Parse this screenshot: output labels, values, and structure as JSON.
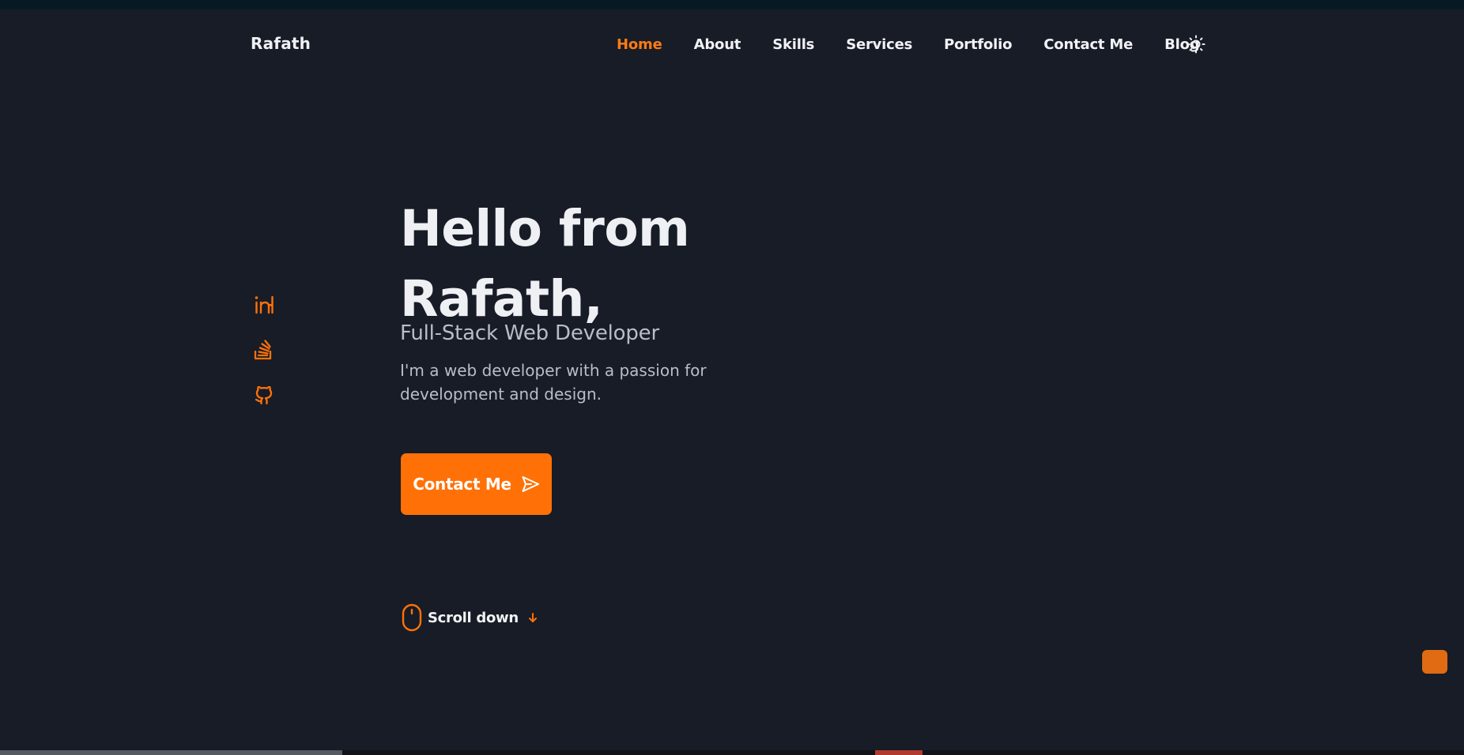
{
  "brand": {
    "name": "Rafath",
    "accent_color": "#ff7107"
  },
  "nav": {
    "items": [
      {
        "label": "Home",
        "active": true
      },
      {
        "label": "About"
      },
      {
        "label": "Skills"
      },
      {
        "label": "Services"
      },
      {
        "label": "Portfolio"
      },
      {
        "label": "Contact Me"
      },
      {
        "label": "Blog"
      }
    ],
    "theme_toggle_icon": "sun-icon"
  },
  "socials": [
    {
      "icon": "linkedin-icon"
    },
    {
      "icon": "stackoverflow-icon"
    },
    {
      "icon": "github-icon"
    }
  ],
  "hero": {
    "title_line1": "Hello from",
    "title_line2": "Rafath,",
    "subtitle": "Full-Stack Web Developer",
    "description": "I'm a web developer with a passion for development and design.",
    "cta_label": "Contact Me",
    "cta_icon": "send-icon"
  },
  "scroll": {
    "label": "Scroll down",
    "icon": "mouse-icon",
    "arrow_icon": "arrow-down-icon"
  },
  "colors": {
    "background": "#171c27",
    "text": "#eef0f4",
    "muted_text": "#b9bdc6",
    "accent": "#ff7107"
  }
}
